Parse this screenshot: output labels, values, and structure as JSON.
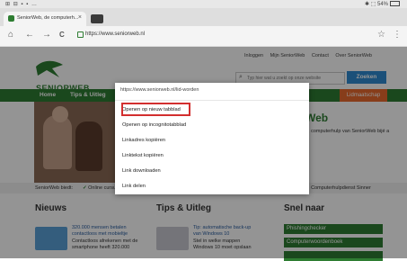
{
  "statusbar": {
    "left": "⊞ ⊟ ▪ ▪ …",
    "right": "✱ ⬚ 54%"
  },
  "tab": {
    "title": "SeniorWeb, de computerh...",
    "close": "×"
  },
  "toolbar": {
    "home": "⌂",
    "back": "←",
    "forward": "→",
    "reload": "C",
    "url": "https://www.seniorweb.nl",
    "star": "☆",
    "menu": "⋮"
  },
  "site": {
    "logo_text": "SENIORWEB",
    "top_links": [
      "Inloggen",
      "Mijn SeniorWeb",
      "Contact",
      "Over SeniorWeb"
    ],
    "search_placeholder": "Typ hier wat u zoekt op onze website",
    "search_button": "Zoeken",
    "nav": [
      "Home",
      "Tips & Uitleg"
    ],
    "lidmaatschap": "Lidmaatschap",
    "hero_title": "Web",
    "hero_text": "... computerhulp van SeniorWeb bijé a ...",
    "strip_left": "SeniorWeb biedt:",
    "strip_middle": "Online cursussen",
    "strip_right": "Computerhulpdienst Sinner",
    "sections": {
      "nieuws": "Nieuws",
      "tips": "Tips & Uitleg",
      "snel": "Snel naar"
    },
    "news": [
      "320.000 mensen betalen",
      "contactloos met mobieltje",
      "Contactloos afrekenen met de",
      "smartphone heeft 320.000"
    ],
    "tips": [
      "Tip: automatische back-up",
      "van Windows 10",
      "Stel in welke mappen",
      "Windows 10 moet opslaan"
    ],
    "quick": [
      "Phishingchecker",
      "Computerwoordenboek",
      ""
    ]
  },
  "context_menu": {
    "header": "https://www.seniorweb.nl/lid-worden",
    "items": [
      "Openen op nieuw tabblad",
      "Openen op incognitotabblad",
      "Linkadres kopiëren",
      "Linktekst kopiëren",
      "Link downloaden",
      "Link delen"
    ]
  },
  "colors": {
    "brand_green": "#2e7d32",
    "search_blue": "#2f8bd0",
    "orange": "#e86a2e",
    "highlight_red": "#d32f2f"
  }
}
